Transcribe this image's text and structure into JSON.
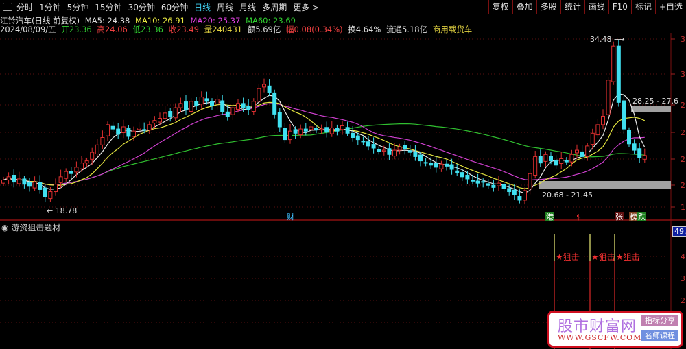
{
  "toolbar": {
    "periods": [
      "分时",
      "1分钟",
      "5分钟",
      "15分钟",
      "30分钟",
      "60分钟",
      "日线",
      "周线",
      "月线",
      "多周期",
      "更多 >"
    ],
    "active": "日线",
    "buttons": [
      "复权",
      "叠加",
      "多股",
      "统计",
      "画线",
      "F10",
      "标记",
      "+自选"
    ]
  },
  "stock": {
    "name": "江铃汽车(日线 前复权)",
    "ma5": "MA5: 24.38",
    "ma10": "MA10: 26.91",
    "ma20": "MA20: 25.37",
    "ma60": "MA60: 23.69",
    "date": "2024/08/09/五",
    "open": "开23.36",
    "high": "高24.06",
    "low": "低23.36",
    "close": "收23.49",
    "volume": "量240431",
    "amount": "额5.69亿",
    "change": "幅0.08(0.34%)",
    "turnover": "换4.64%",
    "float": "流通5.18亿",
    "sector": "商用载货车"
  },
  "chart_data": {
    "type": "candlestick",
    "closes": [
      21.2,
      21.5,
      21.0,
      21.3,
      20.8,
      20.6,
      21.0,
      20.3,
      19.6,
      20.1,
      20.8,
      21.5,
      22.0,
      21.8,
      22.4,
      22.8,
      23.0,
      23.8,
      24.5,
      25.2,
      26.4,
      26.0,
      25.5,
      26.2,
      25.3,
      25.8,
      26.1,
      25.9,
      26.4,
      26.8,
      27.0,
      27.5,
      27.2,
      28.0,
      28.4,
      27.8,
      28.6,
      28.2,
      29.0,
      28.6,
      28.2,
      28.8,
      27.6,
      27.2,
      28.0,
      28.4,
      28.0,
      27.8,
      28.6,
      29.8,
      30.2,
      29.4,
      27.4,
      26.2,
      25.0,
      25.8,
      25.6,
      26.0,
      25.8,
      26.2,
      25.9,
      26.0,
      25.7,
      26.1,
      25.8,
      26.3,
      25.6,
      25.2,
      25.0,
      24.8,
      24.4,
      24.2,
      23.9,
      24.0,
      23.6,
      24.0,
      24.3,
      24.1,
      23.8,
      23.4,
      23.0,
      22.8,
      22.6,
      22.4,
      22.7,
      22.5,
      22.2,
      21.9,
      21.5,
      21.3,
      21.1,
      20.9,
      21.0,
      20.7,
      20.5,
      20.9,
      20.4,
      20.1,
      19.8,
      19.3,
      20.2,
      21.8,
      23.4,
      22.8,
      23.6,
      23.0,
      22.6,
      23.2,
      22.9,
      23.6,
      24.0,
      23.4,
      24.4,
      25.6,
      26.4,
      27.2,
      30.6,
      33.8,
      28.5,
      26.0,
      24.6,
      24.0,
      23.3,
      23.5
    ],
    "max_label": "34.48",
    "min_label": "18.78",
    "zone_upper": "28.25 - 27.6",
    "zone_lower": "20.68 - 21.45",
    "y_axis_labels": [
      "3",
      "3",
      "2",
      "2",
      "2",
      "2",
      "1"
    ],
    "colors": {
      "up": "#e03030",
      "down": "#40e0f0",
      "ma5": "#e8e8e8",
      "ma10": "#e6e640",
      "ma20": "#d040d0",
      "ma60": "#30c030"
    }
  },
  "markers": {
    "cai": "财",
    "gang": "港",
    "dollar": "$",
    "zhang": "张",
    "bang": "榜",
    "die": "跌"
  },
  "indicator": {
    "title": "游资狙击题材",
    "value_badge": "49.1",
    "signal": "★狙击",
    "axis": [
      "4",
      "3",
      "2"
    ]
  },
  "watermark": {
    "logo": "股市财富网",
    "url": "WWW.GSCFW.COM",
    "b1": "指标分享",
    "b2": "名师课程"
  }
}
